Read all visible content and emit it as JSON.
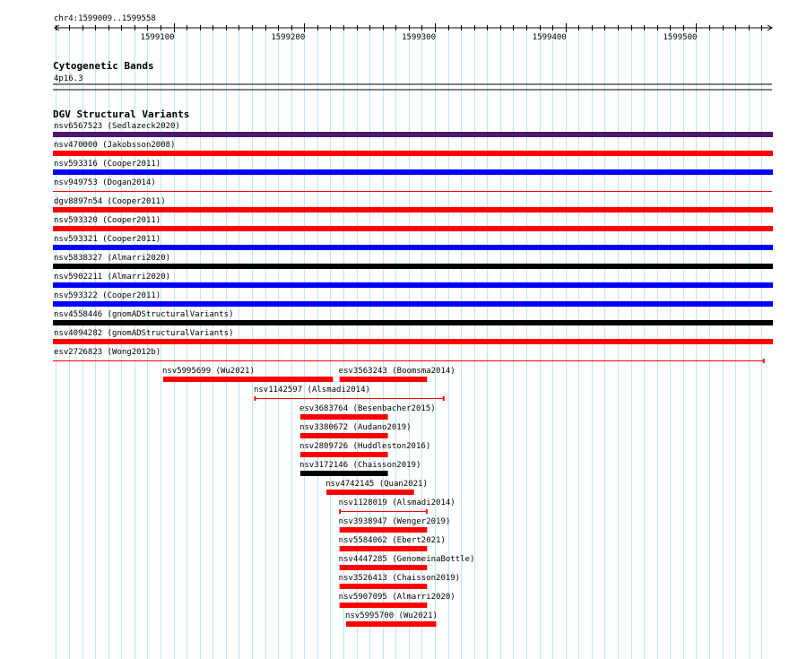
{
  "region": {
    "label": "chr4:1599009..1599558",
    "start": 1599009,
    "end": 1599558,
    "ticks": [
      {
        "pos": 1599100,
        "label": "1599100"
      },
      {
        "pos": 1599200,
        "label": "1599200"
      },
      {
        "pos": 1599300,
        "label": "1599300"
      },
      {
        "pos": 1599400,
        "label": "1599400"
      },
      {
        "pos": 1599500,
        "label": "1599500"
      }
    ]
  },
  "cytoband": {
    "title": "Cytogenetic Bands",
    "band": "4p16.3"
  },
  "dgv": {
    "title": "DGV Structural Variants",
    "features": [
      {
        "name": "nsv6567523 (Sedlazeck2020)",
        "start": 1599009,
        "end": 1599558,
        "style": "bar",
        "color": "#4b1a6e"
      },
      {
        "name": "nsv470000 (Jakobsson2008)",
        "start": 1599009,
        "end": 1599558,
        "style": "bar",
        "color": "#ff0000"
      },
      {
        "name": "nsv593316 (Cooper2011)",
        "start": 1599009,
        "end": 1599558,
        "style": "bar",
        "color": "#0000ff"
      },
      {
        "name": "nsv949753 (Dogan2014)",
        "start": 1599009,
        "end": 1599558,
        "style": "thin",
        "color": "#ff0000"
      },
      {
        "name": "dgv8897n54 (Cooper2011)",
        "start": 1599009,
        "end": 1599558,
        "style": "bar",
        "color": "#ff0000"
      },
      {
        "name": "nsv593320 (Cooper2011)",
        "start": 1599009,
        "end": 1599558,
        "style": "bar",
        "color": "#ff0000"
      },
      {
        "name": "nsv593321 (Cooper2011)",
        "start": 1599009,
        "end": 1599558,
        "style": "bar",
        "color": "#0000ff"
      },
      {
        "name": "nsv5838327 (Almarri2020)",
        "start": 1599009,
        "end": 1599558,
        "style": "bar",
        "color": "#000000"
      },
      {
        "name": "nsv5902211 (Almarri2020)",
        "start": 1599009,
        "end": 1599558,
        "style": "bar",
        "color": "#0000ff"
      },
      {
        "name": "nsv593322 (Cooper2011)",
        "start": 1599009,
        "end": 1599558,
        "style": "bar",
        "color": "#0000ff"
      },
      {
        "name": "nsv4558446 (gnomADStructuralVariants)",
        "start": 1599009,
        "end": 1599558,
        "style": "bar",
        "color": "#000000"
      },
      {
        "name": "nsv4094282 (gnomADStructuralVariants)",
        "start": 1599009,
        "end": 1599558,
        "style": "bar",
        "color": "#ff0000"
      },
      {
        "name": "esv2726823 (Wong2012b)",
        "start": 1599009,
        "end": 1599552,
        "style": "thin",
        "color": "#ff0000"
      },
      {
        "name": "nsv5995699 (Wu2021)",
        "start": 1599092,
        "end": 1599222,
        "style": "bar",
        "color": "#ff0000",
        "row": 0
      },
      {
        "name": "esv3563243 (Boomsma2014)",
        "start": 1599227,
        "end": 1599294,
        "style": "bar",
        "color": "#ff0000",
        "row": 0
      },
      {
        "name": "nsv1142597 (Alsmadi2014)",
        "start": 1599162,
        "end": 1599307,
        "style": "thin",
        "color": "#ff0000",
        "row": 1
      },
      {
        "name": "esv3683764 (Besenbacher2015)",
        "start": 1599197,
        "end": 1599264,
        "style": "bar",
        "color": "#ff0000",
        "row": 2
      },
      {
        "name": "nsv3380672 (Audano2019)",
        "start": 1599197,
        "end": 1599264,
        "style": "bar",
        "color": "#ff0000",
        "row": 3
      },
      {
        "name": "nsv2809726 (Huddleston2016)",
        "start": 1599197,
        "end": 1599264,
        "style": "bar",
        "color": "#ff0000",
        "row": 4
      },
      {
        "name": "nsv3172146 (Chaisson2019)",
        "start": 1599197,
        "end": 1599264,
        "style": "bar",
        "color": "#000000",
        "row": 5
      },
      {
        "name": "nsv4742145 (Quan2021)",
        "start": 1599217,
        "end": 1599284,
        "style": "bar",
        "color": "#ff0000",
        "row": 6
      },
      {
        "name": "nsv1128019 (Alsmadi2014)",
        "start": 1599227,
        "end": 1599294,
        "style": "thin",
        "color": "#ff0000",
        "row": 7
      },
      {
        "name": "nsv3938947 (Wenger2019)",
        "start": 1599227,
        "end": 1599294,
        "style": "bar",
        "color": "#ff0000",
        "row": 8
      },
      {
        "name": "nsv5584062 (Ebert2021)",
        "start": 1599227,
        "end": 1599294,
        "style": "bar",
        "color": "#ff0000",
        "row": 9
      },
      {
        "name": "nsv4447285 (GenomeinaBottle)",
        "start": 1599227,
        "end": 1599294,
        "style": "bar",
        "color": "#ff0000",
        "row": 10
      },
      {
        "name": "nsv3526413 (Chaisson2019)",
        "start": 1599227,
        "end": 1599294,
        "style": "bar",
        "color": "#ff0000",
        "row": 11
      },
      {
        "name": "nsv5907095 (Almarri2020)",
        "start": 1599227,
        "end": 1599294,
        "style": "bar",
        "color": "#ff0000",
        "row": 12
      },
      {
        "name": "nsv5995700 (Wu2021)",
        "start": 1599232,
        "end": 1599301,
        "style": "bar",
        "color": "#ff0000",
        "row": 13
      }
    ]
  }
}
